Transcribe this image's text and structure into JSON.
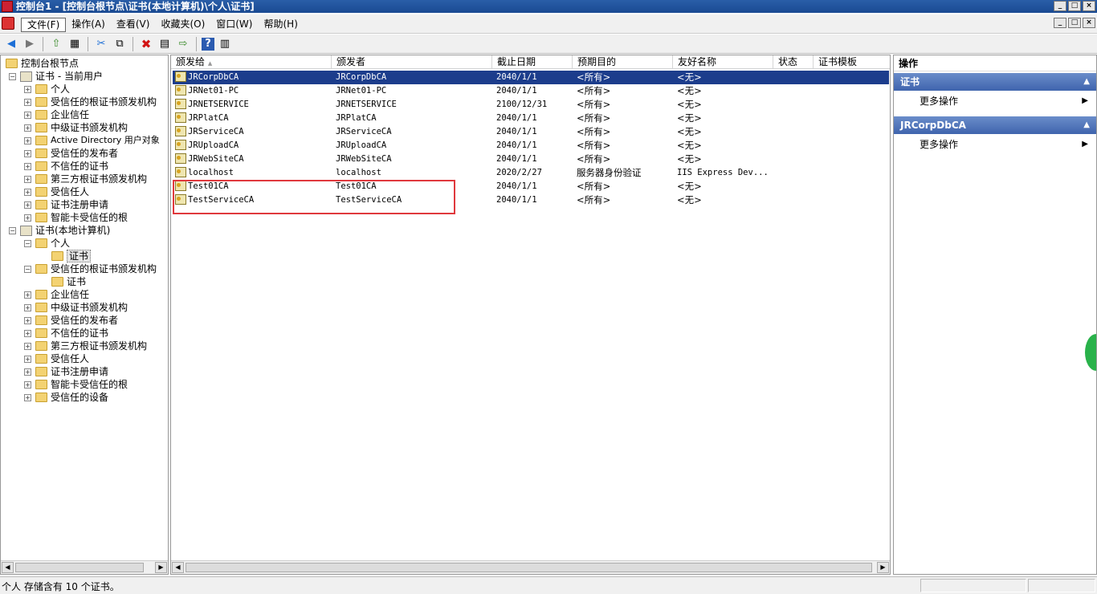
{
  "window": {
    "title": "控制台1 - [控制台根节点\\证书(本地计算机)\\个人\\证书]"
  },
  "menu": [
    "文件(F)",
    "操作(A)",
    "查看(V)",
    "收藏夹(O)",
    "窗口(W)",
    "帮助(H)"
  ],
  "window_buttons": {
    "minimize": "_",
    "restore": "□",
    "close": "×"
  },
  "toolbar": {
    "back": "◀",
    "forward": "▶",
    "up": "⇧",
    "grid": "▦",
    "cut": "✂",
    "copy": "⧉",
    "delete": "✖",
    "properties": "▤",
    "export": "⇨",
    "help": "?",
    "view": "▥"
  },
  "tree": [
    {
      "label": "控制台根节点",
      "depth": 0,
      "expander": "",
      "icon": "folder"
    },
    {
      "label": "证书 - 当前用户",
      "depth": 1,
      "expander": "−",
      "icon": "cert"
    },
    {
      "label": "个人",
      "depth": 2,
      "expander": "+",
      "icon": "folder"
    },
    {
      "label": "受信任的根证书颁发机构",
      "depth": 2,
      "expander": "+",
      "icon": "folder"
    },
    {
      "label": "企业信任",
      "depth": 2,
      "expander": "+",
      "icon": "folder"
    },
    {
      "label": "中级证书颁发机构",
      "depth": 2,
      "expander": "+",
      "icon": "folder"
    },
    {
      "label": "Active Directory 用户对象",
      "depth": 2,
      "expander": "+",
      "icon": "folder"
    },
    {
      "label": "受信任的发布者",
      "depth": 2,
      "expander": "+",
      "icon": "folder"
    },
    {
      "label": "不信任的证书",
      "depth": 2,
      "expander": "+",
      "icon": "folder"
    },
    {
      "label": "第三方根证书颁发机构",
      "depth": 2,
      "expander": "+",
      "icon": "folder"
    },
    {
      "label": "受信任人",
      "depth": 2,
      "expander": "+",
      "icon": "folder"
    },
    {
      "label": "证书注册申请",
      "depth": 2,
      "expander": "+",
      "icon": "folder"
    },
    {
      "label": "智能卡受信任的根",
      "depth": 2,
      "expander": "+",
      "icon": "folder"
    },
    {
      "label": "证书(本地计算机)",
      "depth": 1,
      "expander": "−",
      "icon": "cert"
    },
    {
      "label": "个人",
      "depth": 2,
      "expander": "−",
      "icon": "folder"
    },
    {
      "label": "证书",
      "depth": 3,
      "expander": "",
      "icon": "folder",
      "selected": true
    },
    {
      "label": "受信任的根证书颁发机构",
      "depth": 2,
      "expander": "−",
      "icon": "folder"
    },
    {
      "label": "证书",
      "depth": 3,
      "expander": "",
      "icon": "folder"
    },
    {
      "label": "企业信任",
      "depth": 2,
      "expander": "+",
      "icon": "folder"
    },
    {
      "label": "中级证书颁发机构",
      "depth": 2,
      "expander": "+",
      "icon": "folder"
    },
    {
      "label": "受信任的发布者",
      "depth": 2,
      "expander": "+",
      "icon": "folder"
    },
    {
      "label": "不信任的证书",
      "depth": 2,
      "expander": "+",
      "icon": "folder"
    },
    {
      "label": "第三方根证书颁发机构",
      "depth": 2,
      "expander": "+",
      "icon": "folder"
    },
    {
      "label": "受信任人",
      "depth": 2,
      "expander": "+",
      "icon": "folder"
    },
    {
      "label": "证书注册申请",
      "depth": 2,
      "expander": "+",
      "icon": "folder"
    },
    {
      "label": "智能卡受信任的根",
      "depth": 2,
      "expander": "+",
      "icon": "folder"
    },
    {
      "label": "受信任的设备",
      "depth": 2,
      "expander": "+",
      "icon": "folder"
    }
  ],
  "list": {
    "sort_indicator": "▲",
    "columns": [
      "颁发给",
      "颁发者",
      "截止日期",
      "预期目的",
      "友好名称",
      "状态",
      "证书模板"
    ],
    "rows": [
      [
        "JRCorpDbCA",
        "JRCorpDbCA",
        "2040/1/1",
        "<所有>",
        "<无>",
        "",
        ""
      ],
      [
        "JRNet01-PC",
        "JRNet01-PC",
        "2040/1/1",
        "<所有>",
        "<无>",
        "",
        ""
      ],
      [
        "JRNETSERVICE",
        "JRNETSERVICE",
        "2100/12/31",
        "<所有>",
        "<无>",
        "",
        ""
      ],
      [
        "JRPlatCA",
        "JRPlatCA",
        "2040/1/1",
        "<所有>",
        "<无>",
        "",
        ""
      ],
      [
        "JRServiceCA",
        "JRServiceCA",
        "2040/1/1",
        "<所有>",
        "<无>",
        "",
        ""
      ],
      [
        "JRUploadCA",
        "JRUploadCA",
        "2040/1/1",
        "<所有>",
        "<无>",
        "",
        ""
      ],
      [
        "JRWebSiteCA",
        "JRWebSiteCA",
        "2040/1/1",
        "<所有>",
        "<无>",
        "",
        ""
      ],
      [
        "localhost",
        "localhost",
        "2020/2/27",
        "服务器身份验证",
        "IIS Express Dev...",
        "",
        ""
      ],
      [
        "Test01CA",
        "Test01CA",
        "2040/1/1",
        "<所有>",
        "<无>",
        "",
        ""
      ],
      [
        "TestServiceCA",
        "TestServiceCA",
        "2040/1/1",
        "<所有>",
        "<无>",
        "",
        ""
      ]
    ],
    "selected_row": 0
  },
  "actions": {
    "header": "操作",
    "sections": [
      {
        "title": "证书",
        "items": [
          "更多操作"
        ]
      },
      {
        "title": "JRCorpDbCA",
        "items": [
          "更多操作"
        ]
      }
    ],
    "collapse_caret": "▲",
    "item_arrow": "▶"
  },
  "scroll": {
    "left": "◀",
    "right": "▶"
  },
  "status": {
    "text": "个人 存储含有 10 个证书。"
  }
}
